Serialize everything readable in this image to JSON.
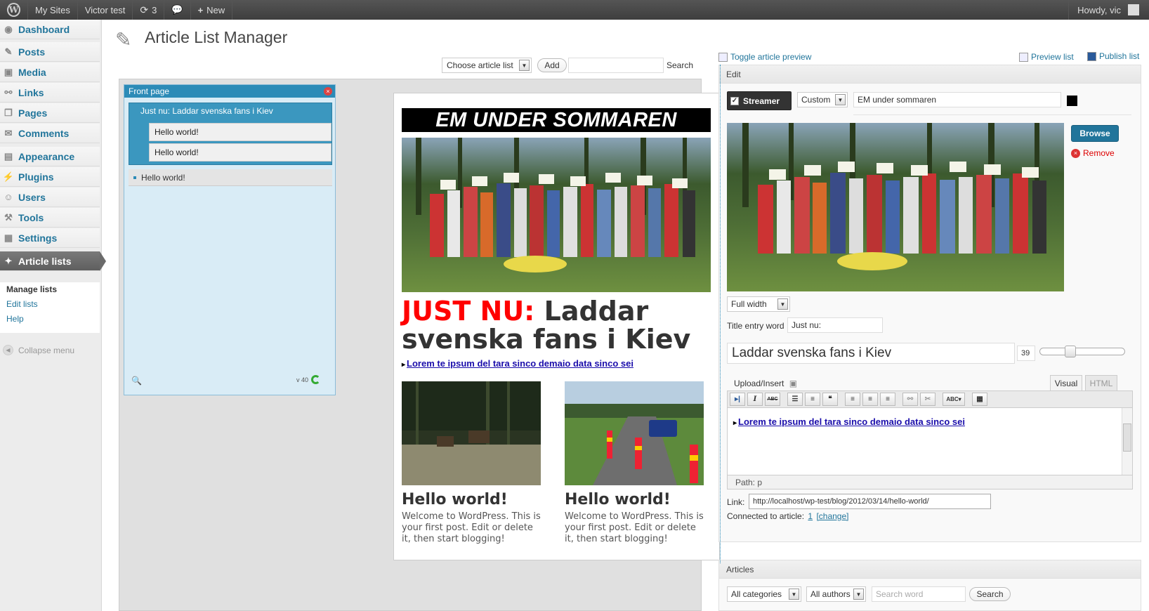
{
  "adminbar": {
    "my_sites": "My Sites",
    "site_name": "Victor test",
    "updates_count": "3",
    "new_label": "New",
    "howdy": "Howdy, vic"
  },
  "sidebar": {
    "items": [
      {
        "label": "Dashboard",
        "icon": "dashboard-icon"
      },
      {
        "label": "Posts",
        "icon": "pin-icon"
      },
      {
        "label": "Media",
        "icon": "media-icon"
      },
      {
        "label": "Links",
        "icon": "link-icon"
      },
      {
        "label": "Pages",
        "icon": "pages-icon"
      },
      {
        "label": "Comments",
        "icon": "comment-icon"
      },
      {
        "label": "Appearance",
        "icon": "appearance-icon"
      },
      {
        "label": "Plugins",
        "icon": "plugin-icon"
      },
      {
        "label": "Users",
        "icon": "users-icon"
      },
      {
        "label": "Tools",
        "icon": "tools-icon"
      },
      {
        "label": "Settings",
        "icon": "settings-icon"
      },
      {
        "label": "Article lists",
        "icon": "article-lists-icon"
      }
    ],
    "submenu": [
      "Manage lists",
      "Edit lists",
      "Help"
    ],
    "collapse": "Collapse menu"
  },
  "page": {
    "title": "Article List Manager",
    "choose_list": "Choose article list",
    "add_label": "Add",
    "search_label": "Search"
  },
  "frontpage": {
    "title": "Front page",
    "group_title": "Just nu: Laddar svenska fans i Kiev",
    "children": [
      "Hello world!",
      "Hello world!"
    ],
    "item": "Hello world!",
    "version": "v 40"
  },
  "preview": {
    "streamer": "EM UNDER SOMMAREN",
    "headline_prefix": "JUST NU:",
    "headline_rest": "Laddar svenska fans i Kiev",
    "link": "Lorem te ipsum del tara sinco demaio data sinco sei",
    "posts": [
      {
        "title": "Hello world!",
        "text": "Welcome to WordPress. This is your first post. Edit or delete it, then start blogging!"
      },
      {
        "title": "Hello world!",
        "text": "Welcome to WordPress. This is your first post. Edit or delete it, then start blogging!"
      }
    ]
  },
  "editpanel": {
    "toggle_preview": "Toggle article preview",
    "preview_list": "Preview list",
    "publish_list": "Publish list",
    "box_title": "Edit",
    "streamer_label": "Streamer",
    "streamer_type": "Custom",
    "streamer_text": "EM under sommaren",
    "streamer_color": "#000000",
    "browse": "Browse",
    "remove": "Remove",
    "width_option": "Full width",
    "title_entry_label": "Title entry word",
    "title_entry_value": "Just nu:",
    "title_value": "Laddar svenska fans i Kiev",
    "font_size": "39",
    "upload_insert": "Upload/Insert",
    "tab_visual": "Visual",
    "tab_html": "HTML",
    "editor_link": "Lorem te ipsum del tara sinco demaio data sinco sei",
    "path": "Path: p",
    "link_label": "Link:",
    "link_value": "http://localhost/wp-test/blog/2012/03/14/hello-world/",
    "connected_label": "Connected to article:",
    "connected_id": "1",
    "change": "[change]"
  },
  "articles": {
    "title": "Articles",
    "categories": "All categories",
    "authors": "All authors",
    "search_placeholder": "Search word",
    "search_btn": "Search"
  }
}
